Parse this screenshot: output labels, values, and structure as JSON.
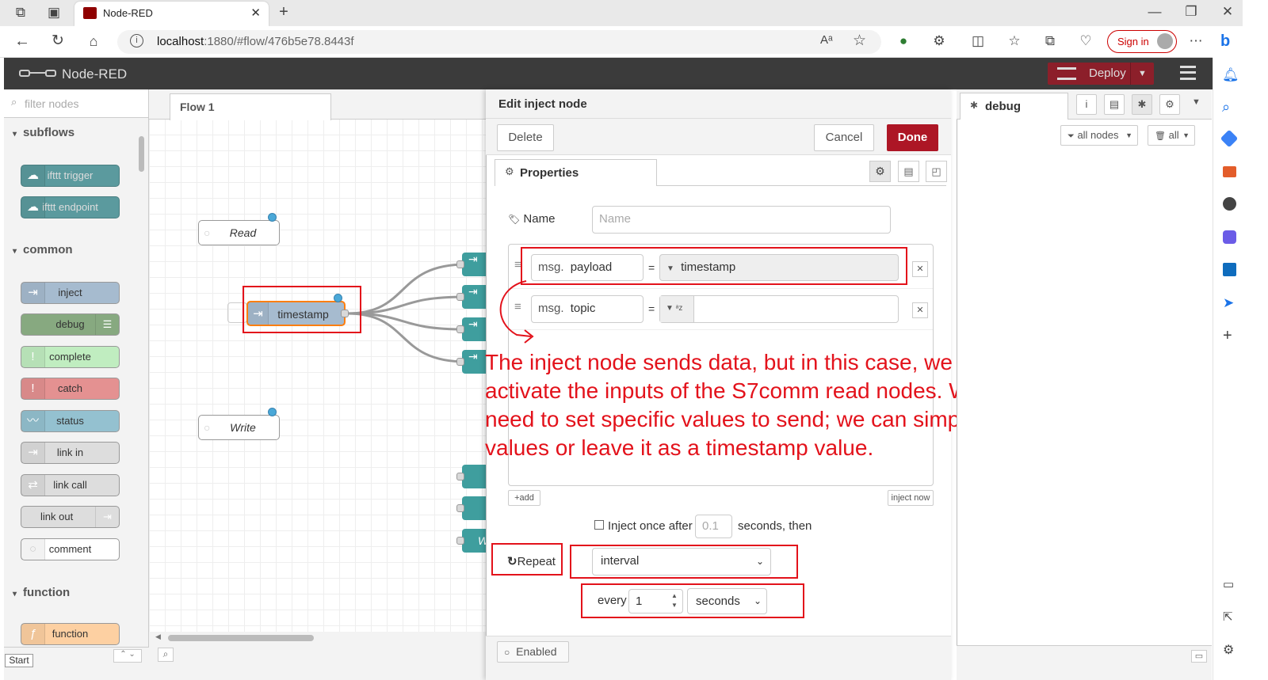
{
  "browser": {
    "tab_title": "Node-RED",
    "url_host": "localhost",
    "url_rest": ":1880/#flow/476b5e78.8443f",
    "sign_in": "Sign in"
  },
  "header": {
    "title": "Node-RED",
    "deploy": "Deploy"
  },
  "palette": {
    "filter_placeholder": "filter nodes",
    "categories": {
      "subflows": "subflows",
      "common": "common",
      "function": "function"
    },
    "nodes": {
      "ifttt_trigger": "ifttt trigger",
      "ifttt_endpoint": "ifttt endpoint",
      "inject": "inject",
      "debug": "debug",
      "complete": "complete",
      "catch": "catch",
      "status": "status",
      "link_in": "link in",
      "link_call": "link call",
      "link_out": "link out",
      "comment": "comment",
      "function": "function"
    },
    "start": "Start"
  },
  "workspace": {
    "tab": "Flow 1",
    "nodes": {
      "read": "Read",
      "timestamp": "timestamp",
      "write": "Write",
      "partial": "W"
    }
  },
  "tray": {
    "title": "Edit inject node",
    "delete": "Delete",
    "cancel": "Cancel",
    "done": "Done",
    "properties_tab": "Properties",
    "name_label": "Name",
    "name_placeholder": "Name",
    "rows": [
      {
        "prefix": "msg.",
        "key": "payload",
        "eq": "=",
        "value": "timestamp"
      },
      {
        "prefix": "msg.",
        "key": "topic",
        "eq": "=",
        "value": ""
      }
    ],
    "add": "add",
    "inject_now": "inject now",
    "inject_once_label": "Inject once after",
    "inject_once_value": "0.1",
    "inject_once_suffix": "seconds, then",
    "repeat_label": "Repeat",
    "repeat_value": "interval",
    "every_label": "every",
    "every_value": "1",
    "units_value": "seconds",
    "enabled": "Enabled"
  },
  "sidebar": {
    "tab": "debug",
    "filter_nodes": "all nodes",
    "clear": "all"
  },
  "annotation": "The inject node sends data, but in this case, we only want to activate the inputs of the S7comm read nodes. We don't need to set specific values to send; we can simply use any values or leave it as a timestamp value.",
  "colors": {
    "header": "#3b3b3b",
    "deploy": "#8c1f2a",
    "done": "#ad1625",
    "annotation": "#e3121b",
    "inject_node": "#a6bbcf",
    "debug_node": "#87a980",
    "complete_node": "#c0edc0",
    "catch_node": "#e49191",
    "teal_node": "#5b9a9e"
  }
}
